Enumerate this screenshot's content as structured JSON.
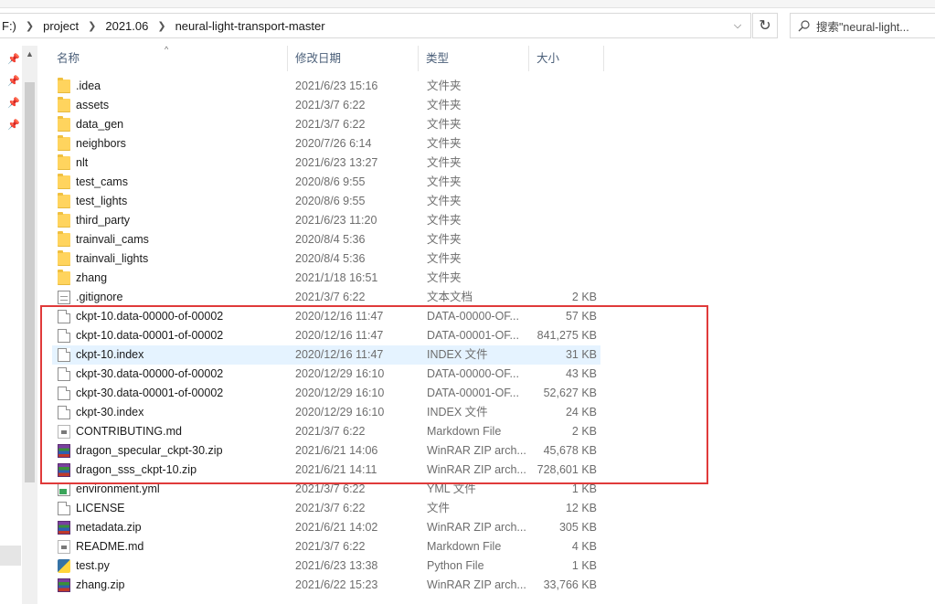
{
  "breadcrumb": {
    "drive_partial": "F:)",
    "items": [
      "project",
      "2021.06",
      "neural-light-transport-master"
    ]
  },
  "search": {
    "placeholder": "搜索\"neural-light..."
  },
  "columns": {
    "name": "名称",
    "modified": "修改日期",
    "type": "类型",
    "size": "大小"
  },
  "files": [
    {
      "name": ".idea",
      "modified": "2021/6/23 15:16",
      "type": "文件夹",
      "size": "",
      "icon": "folder-icon"
    },
    {
      "name": "assets",
      "modified": "2021/3/7 6:22",
      "type": "文件夹",
      "size": "",
      "icon": "folder-icon"
    },
    {
      "name": "data_gen",
      "modified": "2021/3/7 6:22",
      "type": "文件夹",
      "size": "",
      "icon": "folder-icon"
    },
    {
      "name": "neighbors",
      "modified": "2020/7/26 6:14",
      "type": "文件夹",
      "size": "",
      "icon": "folder-icon"
    },
    {
      "name": "nlt",
      "modified": "2021/6/23 13:27",
      "type": "文件夹",
      "size": "",
      "icon": "folder-icon"
    },
    {
      "name": "test_cams",
      "modified": "2020/8/6 9:55",
      "type": "文件夹",
      "size": "",
      "icon": "folder-icon"
    },
    {
      "name": "test_lights",
      "modified": "2020/8/6 9:55",
      "type": "文件夹",
      "size": "",
      "icon": "folder-icon"
    },
    {
      "name": "third_party",
      "modified": "2021/6/23 11:20",
      "type": "文件夹",
      "size": "",
      "icon": "folder-icon"
    },
    {
      "name": "trainvali_cams",
      "modified": "2020/8/4 5:36",
      "type": "文件夹",
      "size": "",
      "icon": "folder-icon"
    },
    {
      "name": "trainvali_lights",
      "modified": "2020/8/4 5:36",
      "type": "文件夹",
      "size": "",
      "icon": "folder-icon"
    },
    {
      "name": "zhang",
      "modified": "2021/1/18 16:51",
      "type": "文件夹",
      "size": "",
      "icon": "folder-icon"
    },
    {
      "name": ".gitignore",
      "modified": "2021/3/7 6:22",
      "type": "文本文档",
      "size": "2 KB",
      "icon": "text-file-icon"
    },
    {
      "name": "ckpt-10.data-00000-of-00002",
      "modified": "2020/12/16 11:47",
      "type": "DATA-00000-OF...",
      "size": "57 KB",
      "icon": "file-icon"
    },
    {
      "name": "ckpt-10.data-00001-of-00002",
      "modified": "2020/12/16 11:47",
      "type": "DATA-00001-OF...",
      "size": "841,275 KB",
      "icon": "file-icon"
    },
    {
      "name": "ckpt-10.index",
      "modified": "2020/12/16 11:47",
      "type": "INDEX 文件",
      "size": "31 KB",
      "icon": "file-icon",
      "selected": true
    },
    {
      "name": "ckpt-30.data-00000-of-00002",
      "modified": "2020/12/29 16:10",
      "type": "DATA-00000-OF...",
      "size": "43 KB",
      "icon": "file-icon"
    },
    {
      "name": "ckpt-30.data-00001-of-00002",
      "modified": "2020/12/29 16:10",
      "type": "DATA-00001-OF...",
      "size": "52,627 KB",
      "icon": "file-icon"
    },
    {
      "name": "ckpt-30.index",
      "modified": "2020/12/29 16:10",
      "type": "INDEX 文件",
      "size": "24 KB",
      "icon": "file-icon"
    },
    {
      "name": "CONTRIBUTING.md",
      "modified": "2021/3/7 6:22",
      "type": "Markdown File",
      "size": "2 KB",
      "icon": "markdown-file-icon"
    },
    {
      "name": "dragon_specular_ckpt-30.zip",
      "modified": "2021/6/21 14:06",
      "type": "WinRAR ZIP arch...",
      "size": "45,678 KB",
      "icon": "winrar-archive-icon"
    },
    {
      "name": "dragon_sss_ckpt-10.zip",
      "modified": "2021/6/21 14:11",
      "type": "WinRAR ZIP arch...",
      "size": "728,601 KB",
      "icon": "winrar-archive-icon"
    },
    {
      "name": "environment.yml",
      "modified": "2021/3/7 6:22",
      "type": "YML 文件",
      "size": "1 KB",
      "icon": "yml-file-icon"
    },
    {
      "name": "LICENSE",
      "modified": "2021/3/7 6:22",
      "type": "文件",
      "size": "12 KB",
      "icon": "file-icon"
    },
    {
      "name": "metadata.zip",
      "modified": "2021/6/21 14:02",
      "type": "WinRAR ZIP arch...",
      "size": "305 KB",
      "icon": "winrar-archive-icon"
    },
    {
      "name": "README.md",
      "modified": "2021/3/7 6:22",
      "type": "Markdown File",
      "size": "4 KB",
      "icon": "markdown-file-icon"
    },
    {
      "name": "test.py",
      "modified": "2021/6/23 13:38",
      "type": "Python File",
      "size": "1 KB",
      "icon": "python-file-icon"
    },
    {
      "name": "zhang.zip",
      "modified": "2021/6/22 15:23",
      "type": "WinRAR ZIP arch...",
      "size": "33,766 KB",
      "icon": "winrar-archive-icon"
    }
  ],
  "colors": {
    "highlight_box": "#e03a3a",
    "selected_row": "#e5f3ff",
    "folder": "#ffd45e"
  }
}
